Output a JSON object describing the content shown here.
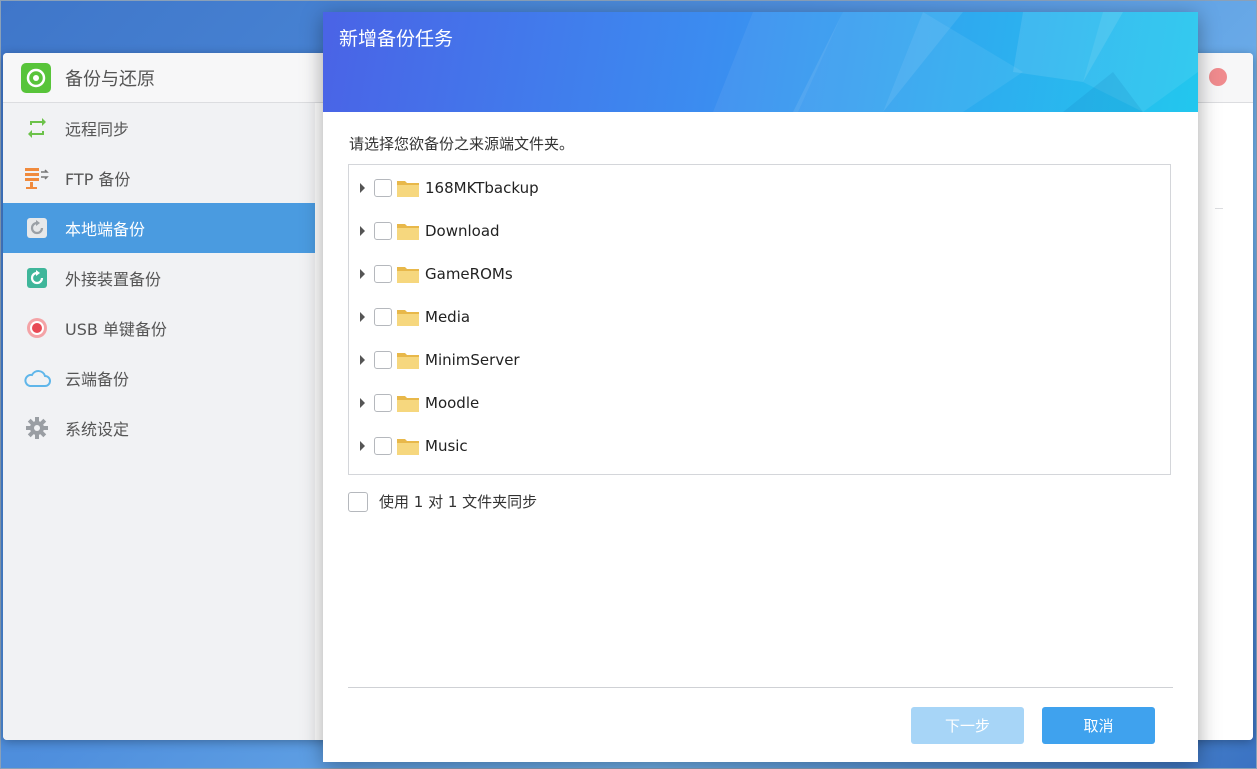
{
  "app": {
    "title": "备份与还原",
    "sidebar": [
      {
        "label": "远程同步",
        "icon": "sync-icon"
      },
      {
        "label": "FTP 备份",
        "icon": "ftp-icon"
      },
      {
        "label": "本地端备份",
        "icon": "local-backup-icon",
        "active": true
      },
      {
        "label": "外接装置备份",
        "icon": "external-device-icon"
      },
      {
        "label": "USB 单键备份",
        "icon": "usb-target-icon"
      },
      {
        "label": "云端备份",
        "icon": "cloud-icon"
      },
      {
        "label": "系统设定",
        "icon": "gear-icon"
      }
    ]
  },
  "dialog": {
    "title": "新增备份任务",
    "instruction": "请选择您欲备份之来源端文件夹。",
    "folders": [
      {
        "name": "168MKTbackup",
        "checked": false
      },
      {
        "name": "Download",
        "checked": false
      },
      {
        "name": "GameROMs",
        "checked": false
      },
      {
        "name": "Media",
        "checked": false
      },
      {
        "name": "MinimServer",
        "checked": false
      },
      {
        "name": "Moodle",
        "checked": false
      },
      {
        "name": "Music",
        "checked": false
      }
    ],
    "sync_option": {
      "label": "使用 1 对 1 文件夹同步",
      "checked": false
    },
    "buttons": {
      "next": "下一步",
      "cancel": "取消"
    }
  },
  "colors": {
    "accent": "#4a9be0",
    "button": "#3fa2ee",
    "button_disabled": "#a7d5f7",
    "close": "#f08b8e"
  }
}
